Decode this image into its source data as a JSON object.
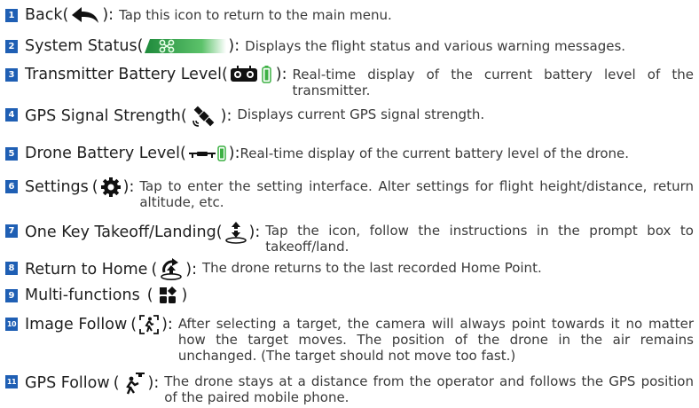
{
  "items": [
    {
      "num": "1",
      "name": "Back",
      "sep": ":",
      "icon": "back-arrow-icon",
      "desc": "Tap this icon to return to the main menu."
    },
    {
      "num": "2",
      "name": "System Status",
      "sep": ":",
      "icon": "status-bar-icon",
      "desc": "Displays the flight status and various warning messages."
    },
    {
      "num": "3",
      "name": "Transmitter Battery Level",
      "sep": ":",
      "icon": "transmitter-battery-icon",
      "desc": "Real-time display of the current battery level of the transmitter."
    },
    {
      "num": "4",
      "name": "GPS Signal Strength",
      "sep": ":",
      "icon": "satellite-icon",
      "desc": "Displays current GPS signal strength."
    },
    {
      "num": "5",
      "name": "Drone Battery Level",
      "sep": ":",
      "icon": "drone-battery-icon",
      "desc": "Real-time display of the current battery level of the drone."
    },
    {
      "num": "6",
      "name": "Settings",
      "sep": ":",
      "icon": "gear-icon",
      "desc": "Tap to enter the setting interface. Alter settings for flight height/distance, return altitude, etc."
    },
    {
      "num": "7",
      "name": "One Key Takeoff/Landing",
      "sep": ":",
      "icon": "takeoff-landing-icon",
      "desc": "Tap the icon, follow the instructions in the prompt box to takeoff/land."
    },
    {
      "num": "8",
      "name": "Return to Home",
      "sep": ":",
      "icon": "return-home-icon",
      "desc": "The drone returns to the last recorded Home Point."
    },
    {
      "num": "9",
      "name": "Multi-functions",
      "sep": "",
      "icon": "multi-functions-icon",
      "desc": ""
    },
    {
      "num": "10",
      "name": "Image Follow",
      "sep": ":",
      "icon": "image-follow-icon",
      "desc": "After selecting a target, the camera will always point towards it no matter how the target moves. The position of the drone in the air remains unchanged. (The target should not move too fast.)"
    },
    {
      "num": "11",
      "name": "GPS Follow",
      "sep": ":",
      "icon": "gps-follow-icon",
      "desc": "The drone stays at a distance from the operator and follows the GPS position of the paired mobile phone."
    }
  ],
  "colors": {
    "badge": "#1f5fb4",
    "status_green": "#34a852",
    "battery_green": "#3cb043"
  }
}
